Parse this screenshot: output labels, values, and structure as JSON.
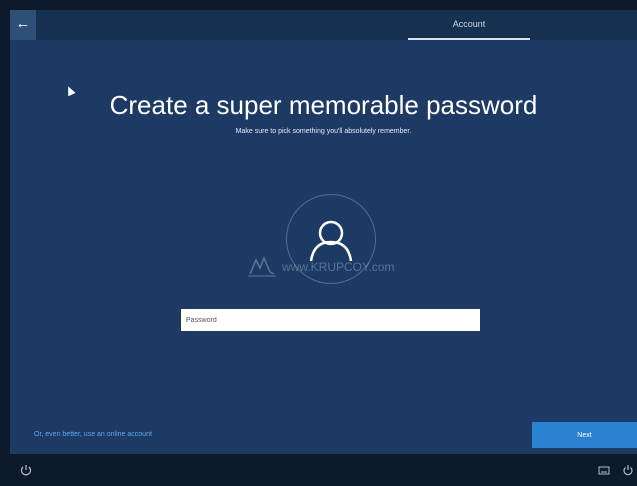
{
  "header": {
    "back_icon": "back-arrow-icon",
    "back_glyph": "←",
    "tab_label": "Account"
  },
  "main": {
    "title": "Create a super memorable password",
    "subtitle": "Make sure to pick something you'll absolutely remember.",
    "avatar_icon": "user-icon",
    "password_placeholder": "Password"
  },
  "watermark": {
    "text": "www.KRUPCOY.com"
  },
  "footer": {
    "online_link": "Or, even better, use an online account",
    "next_label": "Next"
  },
  "taskbar": {
    "accessibility_icon": "ease-of-access-icon",
    "keyboard_icon": "keyboard-icon",
    "power_icon": "power-icon"
  },
  "colors": {
    "background": "#1c3a63",
    "accent": "#2b83cf",
    "link": "#5fa8f0"
  }
}
